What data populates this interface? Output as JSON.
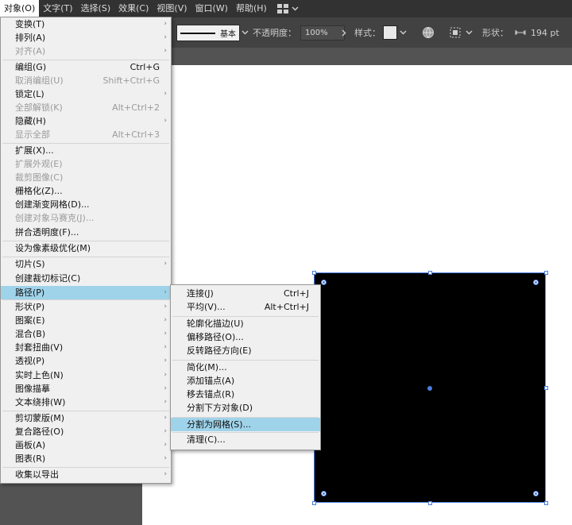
{
  "menubar": {
    "items": [
      {
        "label": "对象(O)"
      },
      {
        "label": "文字(T)"
      },
      {
        "label": "选择(S)"
      },
      {
        "label": "效果(C)"
      },
      {
        "label": "视图(V)"
      },
      {
        "label": "窗口(W)"
      },
      {
        "label": "帮助(H)"
      }
    ],
    "workspace_icon": "grid-icon",
    "workspace_arrow": "chevron-down-icon"
  },
  "control_bar": {
    "stroke_style": "基本",
    "opacity_label": "不透明度：",
    "opacity_value": "100%",
    "style_label": "样式：",
    "shape_label": "形状：",
    "shape_value": "194 pt",
    "colors": {
      "stroke_swatch": "#e8e8e8"
    }
  },
  "object_menu": {
    "items": [
      {
        "label": "变换(T)",
        "submenu": true
      },
      {
        "label": "排列(A)",
        "submenu": true
      },
      {
        "label": "对齐(A)",
        "submenu": true,
        "disabled": true
      },
      {
        "label": "编组(G)",
        "shortcut": "Ctrl+G"
      },
      {
        "label": "取消编组(U)",
        "shortcut": "Shift+Ctrl+G",
        "disabled": true
      },
      {
        "label": "锁定(L)",
        "submenu": true
      },
      {
        "label": "全部解锁(K)",
        "shortcut": "Alt+Ctrl+2",
        "disabled": true
      },
      {
        "label": "隐藏(H)",
        "submenu": true
      },
      {
        "label": "显示全部",
        "shortcut": "Alt+Ctrl+3",
        "disabled": true
      },
      {
        "label": "扩展(X)..."
      },
      {
        "label": "扩展外观(E)",
        "disabled": true
      },
      {
        "label": "裁剪图像(C)",
        "disabled": true
      },
      {
        "label": "栅格化(Z)..."
      },
      {
        "label": "创建渐变网格(D)..."
      },
      {
        "label": "创建对象马赛克(J)...",
        "disabled": true
      },
      {
        "label": "拼合透明度(F)..."
      },
      {
        "label": "设为像素级优化(M)"
      },
      {
        "label": "切片(S)",
        "submenu": true
      },
      {
        "label": "创建裁切标记(C)"
      },
      {
        "label": "路径(P)",
        "submenu": true,
        "highlighted": true
      },
      {
        "label": "形状(P)",
        "submenu": true
      },
      {
        "label": "图案(E)",
        "submenu": true
      },
      {
        "label": "混合(B)",
        "submenu": true
      },
      {
        "label": "封套扭曲(V)",
        "submenu": true
      },
      {
        "label": "透视(P)",
        "submenu": true
      },
      {
        "label": "实时上色(N)",
        "submenu": true
      },
      {
        "label": "图像描摹",
        "submenu": true
      },
      {
        "label": "文本绕排(W)",
        "submenu": true
      },
      {
        "label": "剪切蒙版(M)",
        "submenu": true
      },
      {
        "label": "复合路径(O)",
        "submenu": true
      },
      {
        "label": "画板(A)",
        "submenu": true
      },
      {
        "label": "图表(R)",
        "submenu": true
      },
      {
        "label": "收集以导出",
        "submenu": true
      }
    ]
  },
  "path_menu": {
    "items": [
      {
        "label": "连接(J)",
        "shortcut": "Ctrl+J"
      },
      {
        "label": "平均(V)...",
        "shortcut": "Alt+Ctrl+J"
      },
      {
        "label": "轮廓化描边(U)"
      },
      {
        "label": "偏移路径(O)..."
      },
      {
        "label": "反转路径方向(E)"
      },
      {
        "label": "简化(M)..."
      },
      {
        "label": "添加锚点(A)"
      },
      {
        "label": "移去锚点(R)"
      },
      {
        "label": "分割下方对象(D)"
      },
      {
        "label": "分割为网格(S)...",
        "highlighted": true
      },
      {
        "label": "清理(C)..."
      }
    ]
  },
  "colors": {
    "highlight": "#9fd3ea",
    "selection": "#4a7de0",
    "menu_bg": "#f0f0f0",
    "artwork_fill": "#000000"
  }
}
